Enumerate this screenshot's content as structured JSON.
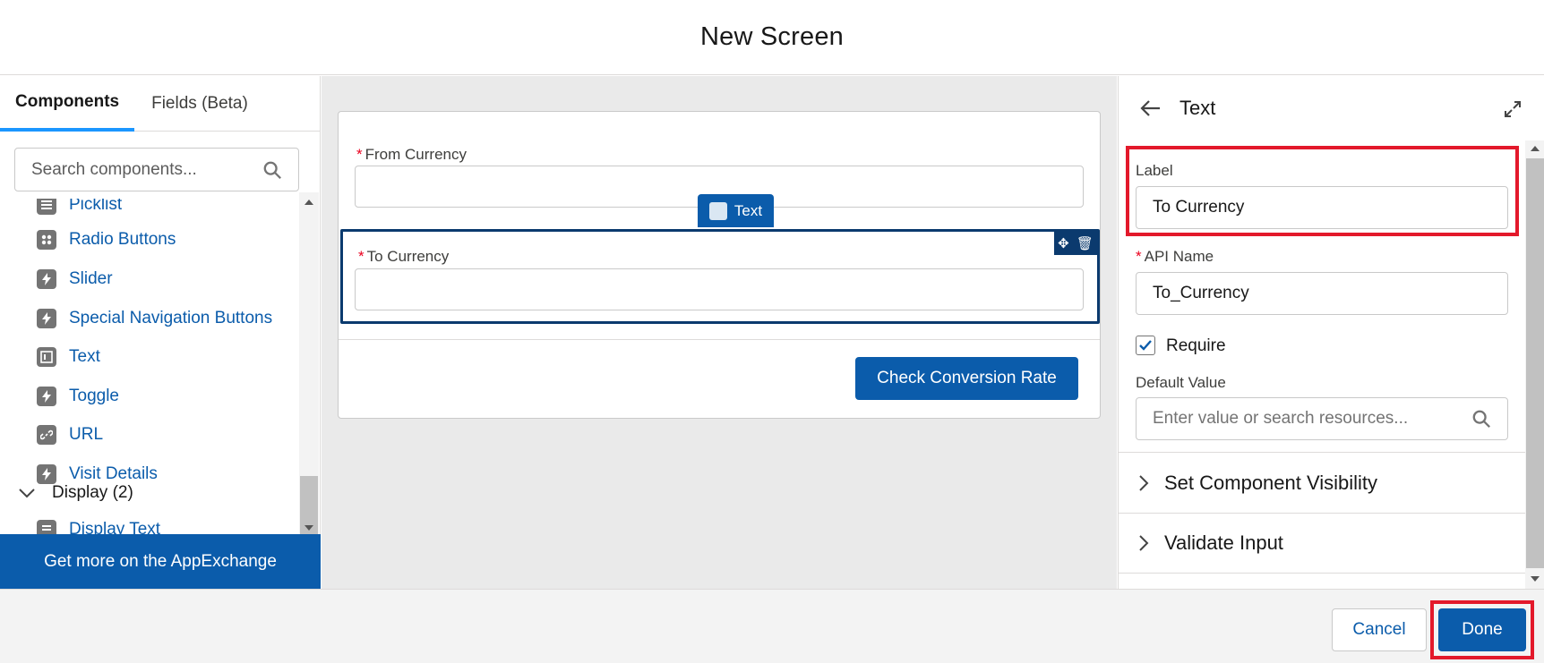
{
  "header": {
    "title": "New Screen"
  },
  "sidebar": {
    "tabs": [
      {
        "label": "Components"
      },
      {
        "label": "Fields (Beta)"
      }
    ],
    "search_placeholder": "Search components...",
    "items": [
      {
        "label": "Picklist",
        "icon": "list-icon"
      },
      {
        "label": "Radio Buttons",
        "icon": "radio-grid-icon"
      },
      {
        "label": "Slider",
        "icon": "lightning-icon"
      },
      {
        "label": "Special Navigation Buttons",
        "icon": "lightning-icon"
      },
      {
        "label": "Text",
        "icon": "text-box-icon"
      },
      {
        "label": "Toggle",
        "icon": "lightning-icon"
      },
      {
        "label": "URL",
        "icon": "link-icon"
      },
      {
        "label": "Visit Details",
        "icon": "lightning-icon"
      }
    ],
    "group": {
      "label": "Display (2)"
    },
    "group_items": [
      {
        "label": "Display Text",
        "icon": "display-text-icon"
      }
    ],
    "appexchange": "Get more on the AppExchange"
  },
  "canvas": {
    "from_label": "From Currency",
    "to_label": "To Currency",
    "badge": "Text",
    "button": "Check Conversion Rate"
  },
  "properties": {
    "title": "Text",
    "label_label": "Label",
    "label_value": "To Currency",
    "api_label": "API Name",
    "api_value": "To_Currency",
    "require_label": "Require",
    "require_checked": true,
    "default_label": "Default Value",
    "default_placeholder": "Enter value or search resources...",
    "sections": [
      {
        "label": "Set Component Visibility"
      },
      {
        "label": "Validate Input"
      }
    ]
  },
  "footer": {
    "cancel": "Cancel",
    "done": "Done"
  },
  "colors": {
    "brand": "#0b5cab",
    "highlight": "#e3192b",
    "required": "#ea001e"
  }
}
